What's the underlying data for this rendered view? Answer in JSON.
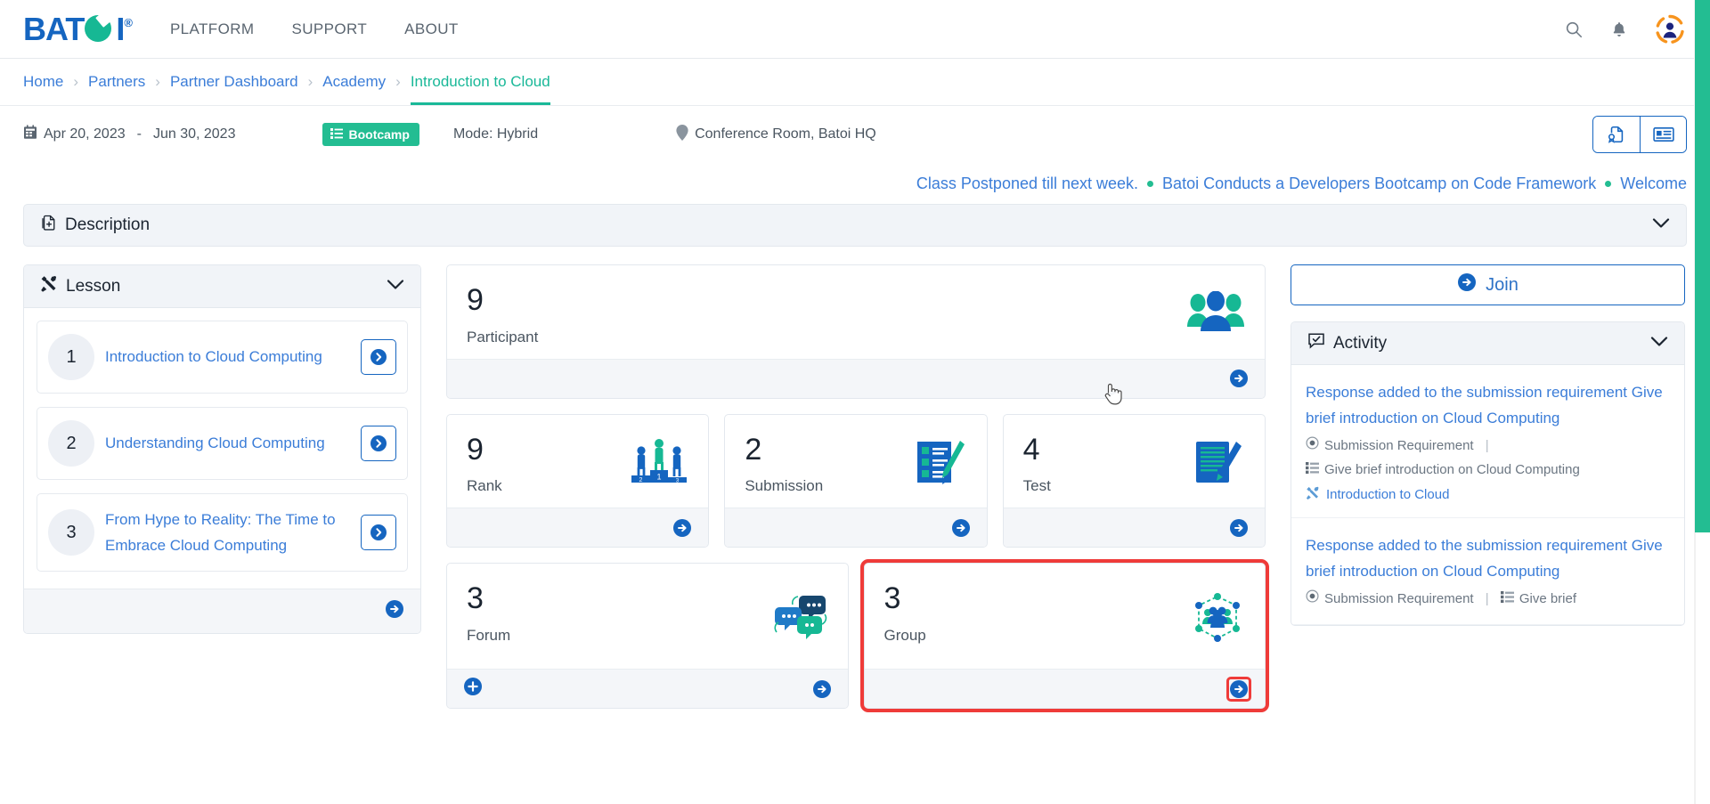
{
  "brand": {
    "name": "BATOI",
    "registered": "®",
    "logo_color": "#1565c0",
    "accent_green": "#16b894"
  },
  "topnav": {
    "links": [
      {
        "label": "PLATFORM"
      },
      {
        "label": "SUPPORT"
      },
      {
        "label": "ABOUT"
      }
    ],
    "search_icon": "search-icon",
    "bell_icon": "notification-bell-icon",
    "avatar": "user-avatar"
  },
  "breadcrumb": {
    "items": [
      {
        "label": "Home",
        "active": false
      },
      {
        "label": "Partners",
        "active": false
      },
      {
        "label": "Partner Dashboard",
        "active": false
      },
      {
        "label": "Academy",
        "active": false
      },
      {
        "label": "Introduction to Cloud",
        "active": true
      }
    ],
    "separator": "›",
    "active_color": "#19b898",
    "link_color": "#3b7dd8"
  },
  "infobar": {
    "date_start": "Apr 20, 2023",
    "date_dash": "-",
    "date_end": "Jun 30, 2023",
    "badge_label": "Bootcamp",
    "badge_color": "#23bd92",
    "mode": "Mode: Hybrid",
    "location": "Conference Room, Batoi HQ",
    "actions": [
      {
        "name": "certificate-button"
      },
      {
        "name": "id-card-button"
      }
    ]
  },
  "ticker": {
    "items": [
      "Class Postponed till next week.",
      "Batoi Conducts a Developers Bootcamp on Code Framework",
      "Welcome"
    ]
  },
  "description": {
    "title": "Description",
    "expanded": false
  },
  "lesson_panel": {
    "title": "Lesson",
    "items": [
      {
        "number": "1",
        "title": "Introduction to Cloud Computing"
      },
      {
        "number": "2",
        "title": "Understanding Cloud Computing"
      },
      {
        "number": "3",
        "title": "From Hype to Reality: The Time to Embrace Cloud Computing"
      }
    ]
  },
  "stats": {
    "participant": {
      "value": "9",
      "label": "Participant",
      "icon": "people-group-icon"
    },
    "rank": {
      "value": "9",
      "label": "Rank",
      "icon": "podium-icon"
    },
    "submission": {
      "value": "2",
      "label": "Submission",
      "icon": "checklist-pen-icon"
    },
    "test": {
      "value": "4",
      "label": "Test",
      "icon": "document-pen-icon"
    },
    "forum": {
      "value": "3",
      "label": "Forum",
      "icon": "chat-bubbles-icon",
      "has_add": true
    },
    "group": {
      "value": "3",
      "label": "Group",
      "icon": "network-people-icon",
      "highlighted": true
    }
  },
  "join_button": {
    "label": "Join"
  },
  "activity_panel": {
    "title": "Activity",
    "items": [
      {
        "title": "Response added to the submission requirement Give brief introduction on Cloud Computing",
        "meta_type": "Submission Requirement",
        "meta_sep": "|",
        "meta_ref": "Give brief introduction on Cloud Computing",
        "link": "Introduction to Cloud"
      },
      {
        "title": "Response added to the submission requirement Give brief introduction on Cloud Computing",
        "meta_type": "Submission Requirement",
        "meta_sep": "|",
        "meta_ref": "Give brief",
        "link": ""
      }
    ]
  },
  "scrollbar": {
    "color": "#23bd92"
  }
}
